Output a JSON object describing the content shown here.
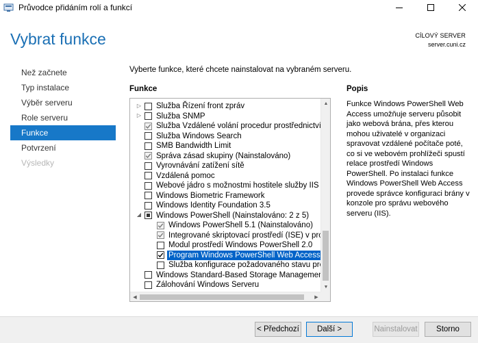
{
  "window": {
    "title": "Průvodce přidáním rolí a funkcí"
  },
  "page": {
    "title": "Vybrat funkce",
    "target_caption": "CÍLOVÝ SERVER",
    "target_server": "server.cuni.cz",
    "instruction": "Vyberte funkce, které chcete nainstalovat na vybraném serveru."
  },
  "nav": {
    "items": [
      {
        "label": "Než začnete",
        "state": "normal"
      },
      {
        "label": "Typ instalace",
        "state": "normal"
      },
      {
        "label": "Výběr serveru",
        "state": "normal"
      },
      {
        "label": "Role serveru",
        "state": "normal"
      },
      {
        "label": "Funkce",
        "state": "active"
      },
      {
        "label": "Potvrzení",
        "state": "normal"
      },
      {
        "label": "Výsledky",
        "state": "disabled"
      }
    ]
  },
  "features": {
    "header": "Funkce",
    "items": [
      {
        "label": "Služba Řízení front zpráv",
        "expander": "collapsed",
        "check": "unchecked",
        "level": 0
      },
      {
        "label": "Služba SNMP",
        "expander": "collapsed",
        "check": "unchecked",
        "level": 0
      },
      {
        "label": "Služba Vzdálené volání procedur prostřednictvím p",
        "expander": "none",
        "check": "checked-disabled",
        "level": 0
      },
      {
        "label": "Služba Windows Search",
        "expander": "none",
        "check": "unchecked",
        "level": 0
      },
      {
        "label": "SMB Bandwidth Limit",
        "expander": "none",
        "check": "unchecked",
        "level": 0
      },
      {
        "label": "Správa zásad skupiny (Nainstalováno)",
        "expander": "none",
        "check": "checked-disabled",
        "level": 0
      },
      {
        "label": "Vyrovnávání zatížení sítě",
        "expander": "none",
        "check": "unchecked",
        "level": 0
      },
      {
        "label": "Vzdálená pomoc",
        "expander": "none",
        "check": "unchecked",
        "level": 0
      },
      {
        "label": "Webové jádro s možnostmi hostitele služby IIS",
        "expander": "none",
        "check": "unchecked",
        "level": 0
      },
      {
        "label": "Windows Biometric Framework",
        "expander": "none",
        "check": "unchecked",
        "level": 0
      },
      {
        "label": "Windows Identity Foundation 3.5",
        "expander": "none",
        "check": "unchecked",
        "level": 0
      },
      {
        "label": "Windows PowerShell (Nainstalováno: 2 z 5)",
        "expander": "expanded",
        "check": "partial",
        "level": 0
      },
      {
        "label": "Windows PowerShell 5.1 (Nainstalováno)",
        "expander": "none",
        "check": "checked-disabled",
        "level": 1
      },
      {
        "label": "Integrované skriptovací prostředí (ISE) v prostř",
        "expander": "none",
        "check": "checked-disabled",
        "level": 1
      },
      {
        "label": "Modul prostředí Windows PowerShell 2.0",
        "expander": "none",
        "check": "unchecked",
        "level": 1
      },
      {
        "label": "Program Windows PowerShell Web Access",
        "expander": "none",
        "check": "checked",
        "level": 1,
        "selected": true
      },
      {
        "label": "Služba konfigurace požadovaného stavu prostř",
        "expander": "none",
        "check": "unchecked",
        "level": 1
      },
      {
        "label": "Windows Standard-Based Storage Management",
        "expander": "none",
        "check": "unchecked",
        "level": 0
      },
      {
        "label": "Zálohování Windows Serveru",
        "expander": "none",
        "check": "unchecked",
        "level": 0
      }
    ]
  },
  "description": {
    "header": "Popis",
    "text": "Funkce Windows PowerShell Web Access umožňuje serveru působit jako webová brána, přes kterou mohou uživatelé v organizaci spravovat vzdálené počítače poté, co si ve webovém prohlížeči spustí relace prostředí Windows PowerShell. Po instalaci funkce Windows PowerShell Web Access provede správce konfiguraci brány v konzole pro správu webového serveru (IIS)."
  },
  "buttons": {
    "prev": "< Předchozí",
    "next": "Další >",
    "install": "Nainstalovat",
    "cancel": "Storno"
  },
  "colors": {
    "accent": "#1778c8",
    "title": "#1a6fb4",
    "selection": "#0063c8"
  }
}
